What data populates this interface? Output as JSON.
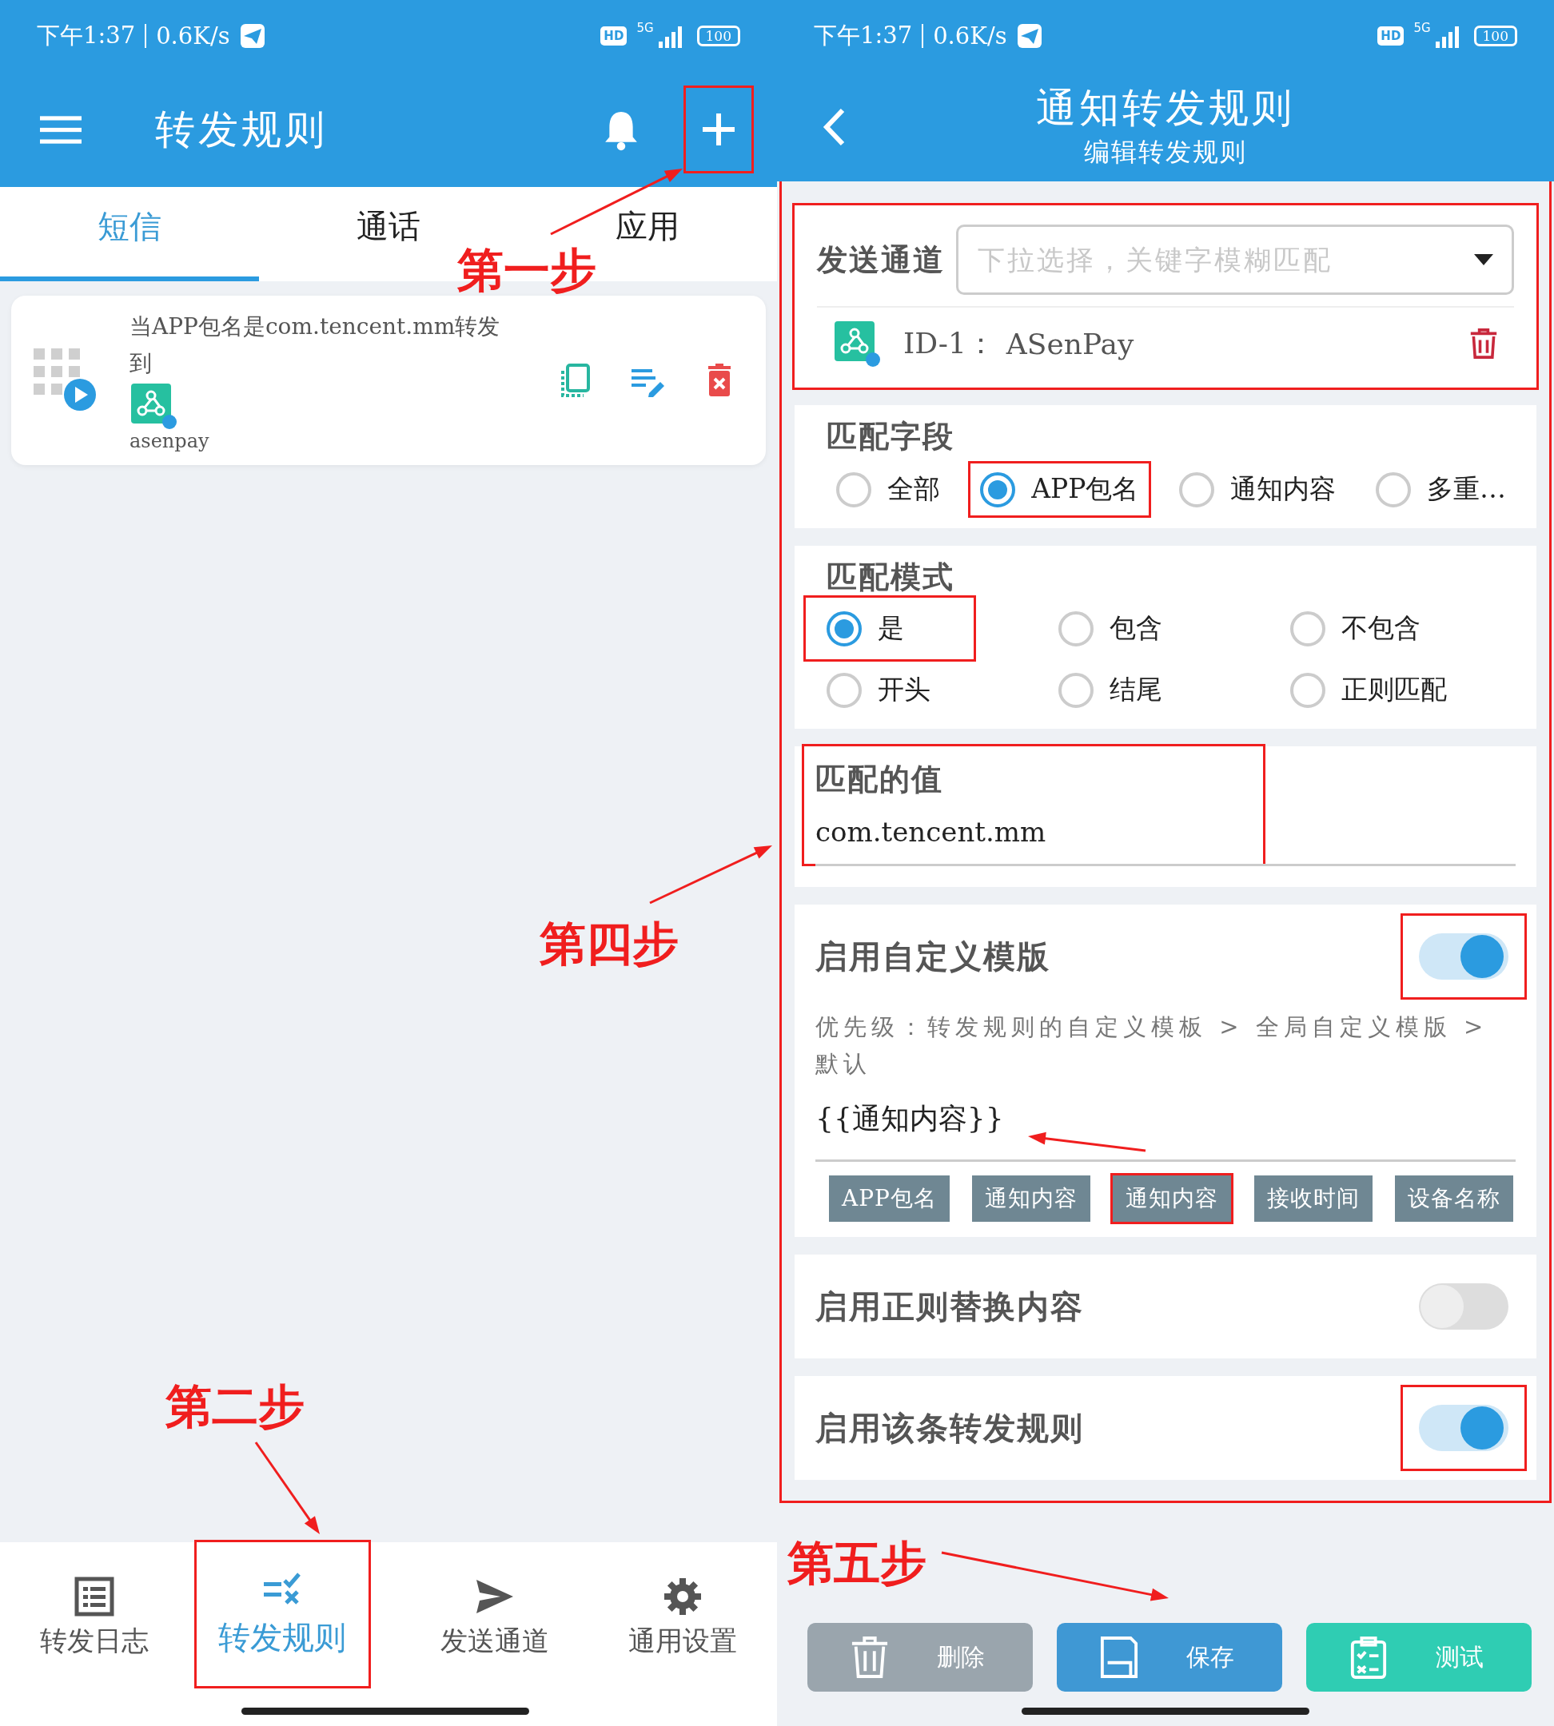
{
  "left": {
    "status_bar": {
      "time": "下午1:37",
      "speed": "0.6K/s",
      "hd": "HD",
      "network": "5G",
      "battery": "100"
    },
    "app_bar": {
      "title": "转发规则",
      "add_highlighted": true
    },
    "tabs": [
      {
        "label": "短信",
        "selected": true
      },
      {
        "label": "通话",
        "selected": false
      },
      {
        "label": "应用",
        "selected": false
      }
    ],
    "rules": [
      {
        "text": "当APP包名是com.tencent.mm转发到",
        "channel": "asenpay"
      }
    ],
    "nav": [
      {
        "label": "转发日志",
        "kind": "log",
        "selected": false,
        "highlighted": false
      },
      {
        "label": "转发规则",
        "kind": "rules",
        "selected": true,
        "highlighted": true
      },
      {
        "label": "发送通道",
        "kind": "send",
        "selected": false,
        "highlighted": false
      },
      {
        "label": "通用设置",
        "kind": "settings",
        "selected": false,
        "highlighted": false
      }
    ]
  },
  "right": {
    "status_bar": {
      "time": "下午1:37",
      "speed": "0.6K/s",
      "hd": "HD",
      "network": "5G",
      "battery": "100"
    },
    "header": {
      "title": "通知转发规则",
      "subtitle": "编辑转发规则"
    },
    "form_highlighted": true,
    "send_channel": {
      "label": "发送通道",
      "placeholder": "下拉选择，关键字模糊匹配",
      "channel_id": "ID-1：",
      "channel_name": "ASenPay",
      "highlighted": true
    },
    "match_field": {
      "label": "匹配字段",
      "options": [
        {
          "label": "全部",
          "selected": false,
          "highlighted": false
        },
        {
          "label": "APP包名",
          "selected": true,
          "highlighted": true
        },
        {
          "label": "通知内容",
          "selected": false,
          "highlighted": false
        },
        {
          "label": "多重…",
          "selected": false,
          "highlighted": false
        }
      ]
    },
    "match_mode": {
      "label": "匹配模式",
      "options": [
        {
          "label": "是",
          "selected": true,
          "highlighted": true
        },
        {
          "label": "包含",
          "selected": false,
          "highlighted": false
        },
        {
          "label": "不包含",
          "selected": false,
          "highlighted": false
        },
        {
          "label": "开头",
          "selected": false,
          "highlighted": false
        },
        {
          "label": "结尾",
          "selected": false,
          "highlighted": false
        },
        {
          "label": "正则匹配",
          "selected": false,
          "highlighted": false
        }
      ]
    },
    "match_value": {
      "label": "匹配的值",
      "value": "com.tencent.mm",
      "highlighted": true
    },
    "custom_template": {
      "label": "启用自定义模版",
      "on": true,
      "highlighted": true,
      "hint": "优先级：转发规则的自定义模板 > 全局自定义模版 > 默认",
      "value": "{{通知内容}}",
      "chips": [
        {
          "label": "APP包名",
          "highlighted": false
        },
        {
          "label": "通知内容",
          "highlighted": false
        },
        {
          "label": "通知内容",
          "highlighted": true
        },
        {
          "label": "接收时间",
          "highlighted": false
        },
        {
          "label": "设备名称",
          "highlighted": false
        }
      ]
    },
    "toggles": [
      {
        "label": "启用正则替换内容",
        "on": false,
        "highlighted": false
      },
      {
        "label": "启用该条转发规则",
        "on": true,
        "highlighted": true
      }
    ],
    "buttons": [
      {
        "label": "删除",
        "kind": "delete"
      },
      {
        "label": "保存",
        "kind": "save"
      },
      {
        "label": "测试",
        "kind": "test"
      }
    ]
  },
  "annotations": [
    {
      "text": "第一步"
    },
    {
      "text": "第二步"
    },
    {
      "text": "第四步"
    },
    {
      "text": "第五步"
    }
  ]
}
